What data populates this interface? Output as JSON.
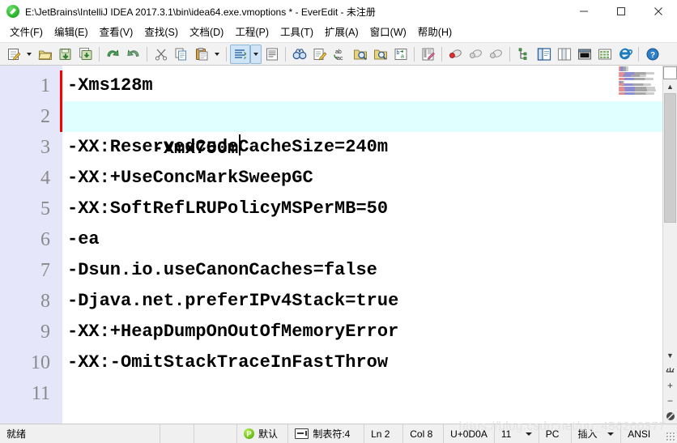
{
  "window": {
    "title": "E:\\JetBrains\\IntelliJ IDEA 2017.3.1\\bin\\idea64.exe.vmoptions * - EverEdit - 未注册",
    "app_icon": "everedit-pencil-icon",
    "minimize_label": "—",
    "maximize_label": "□",
    "close_label": "✕"
  },
  "menubar": {
    "items": [
      {
        "label": "文件(F)"
      },
      {
        "label": "编辑(E)"
      },
      {
        "label": "查看(V)"
      },
      {
        "label": "查找(S)"
      },
      {
        "label": "文档(D)"
      },
      {
        "label": "工程(P)"
      },
      {
        "label": "工具(T)"
      },
      {
        "label": "扩展(A)"
      },
      {
        "label": "窗口(W)"
      },
      {
        "label": "帮助(H)"
      }
    ]
  },
  "toolbar": {
    "buttons": [
      {
        "name": "new-file",
        "icon": "new-document-icon"
      },
      {
        "name": "new-file-dropdown",
        "icon": "chevron-down-icon"
      },
      {
        "name": "open-file",
        "icon": "open-folder-icon"
      },
      {
        "name": "save-file",
        "icon": "save-disk-icon"
      },
      {
        "name": "save-all",
        "icon": "save-all-icon"
      },
      {
        "name": "undo",
        "icon": "undo-arrow-icon"
      },
      {
        "name": "redo",
        "icon": "redo-arrow-icon"
      },
      {
        "name": "cut",
        "icon": "scissors-icon"
      },
      {
        "name": "copy",
        "icon": "copy-pages-icon"
      },
      {
        "name": "paste",
        "icon": "clipboard-icon"
      },
      {
        "name": "paste-dropdown",
        "icon": "chevron-down-icon"
      },
      {
        "name": "sort-lines",
        "icon": "sort-lines-icon"
      },
      {
        "name": "sort-dropdown",
        "icon": "chevron-down-icon"
      },
      {
        "name": "word-wrap",
        "icon": "wrap-text-icon"
      },
      {
        "name": "find",
        "icon": "binoculars-icon"
      },
      {
        "name": "replace",
        "icon": "edit-pencil-icon"
      },
      {
        "name": "replace-all",
        "icon": "abc-replace-icon"
      },
      {
        "name": "find-in-files",
        "icon": "find-in-files-icon"
      },
      {
        "name": "find-files-magnify",
        "icon": "magnify-folder-icon"
      },
      {
        "name": "translate",
        "icon": "translate-ba-icon"
      },
      {
        "name": "hex-view",
        "icon": "hex-edit-icon"
      },
      {
        "name": "bookmark-toggle",
        "icon": "bookmark-red-icon"
      },
      {
        "name": "bookmark-prev",
        "icon": "bookmark-prev-icon"
      },
      {
        "name": "bookmark-next",
        "icon": "bookmark-next-icon"
      },
      {
        "name": "project-tree",
        "icon": "tree-nodes-icon"
      },
      {
        "name": "explorer-panel",
        "icon": "side-panel-icon"
      },
      {
        "name": "split-view",
        "icon": "split-view-icon"
      },
      {
        "name": "console",
        "icon": "console-window-icon"
      },
      {
        "name": "snippets",
        "icon": "snippets-grid-icon"
      },
      {
        "name": "browser-preview",
        "icon": "internet-explorer-icon"
      },
      {
        "name": "help",
        "icon": "help-question-icon"
      }
    ]
  },
  "editor": {
    "current_line": 2,
    "modified_lines": [
      1,
      2
    ],
    "cursor_after_col": 8,
    "lines": [
      {
        "num": "1",
        "text": "-Xms128m"
      },
      {
        "num": "2",
        "text": "-Xmx750m"
      },
      {
        "num": "3",
        "text": "-XX:ReservedCodeCacheSize=240m"
      },
      {
        "num": "4",
        "text": "-XX:+UseConcMarkSweepGC"
      },
      {
        "num": "5",
        "text": "-XX:SoftRefLRUPolicyMSPerMB=50"
      },
      {
        "num": "6",
        "text": "-ea"
      },
      {
        "num": "7",
        "text": "-Dsun.io.useCanonCaches=false"
      },
      {
        "num": "8",
        "text": "-Djava.net.preferIPv4Stack=true"
      },
      {
        "num": "9",
        "text": "-XX:+HeapDumpOnOutOfMemoryError"
      },
      {
        "num": "10",
        "text": "-XX:-OmitStackTraceInFastThrow"
      },
      {
        "num": "11",
        "text": ""
      }
    ]
  },
  "scrollbar": {
    "scroll_up": "▲",
    "scroll_down": "▼",
    "split_handle": "split-editor-handle",
    "zoom_in": "+",
    "zoom_out": "−",
    "zoom_reset": "⊘"
  },
  "statusbar": {
    "ready": "就绪",
    "syntax_label": "默认",
    "syntax_badge": "P",
    "tab_label": "制表符:4",
    "line": "Ln 2",
    "column": "Col 8",
    "unicode": "U+0D0A",
    "eol": "11",
    "platform": "PC",
    "insert_mode": "插入",
    "encoding": "ANSI",
    "watermark": "https://blog.csdn.net/qq_456260377"
  },
  "colors": {
    "gutter_bg": "#E6E6FA",
    "current_line_bg": "#E0FFFF",
    "modified_marker": "#FF0000",
    "toolbar_bg": "#F2F2F2",
    "status_bg": "#F0F0F0",
    "accent_active": "#CFE4F7"
  }
}
